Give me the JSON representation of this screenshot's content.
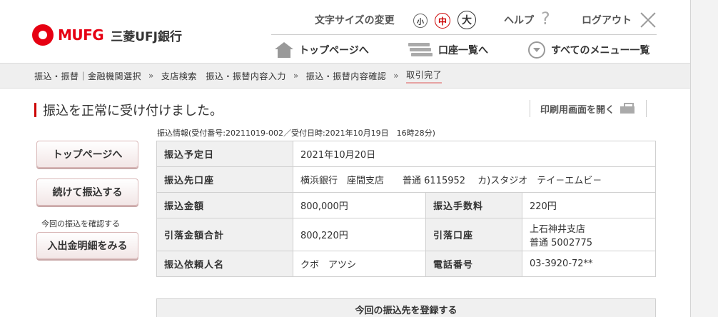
{
  "header": {
    "bank_brand": "MUFG",
    "bank_name": "三菱UFJ銀行",
    "font_size_label": "文字サイズの変更",
    "font_sizes": [
      "小",
      "中",
      "大"
    ],
    "help": "ヘルプ",
    "help_mark": "?",
    "logout": "ログアウト",
    "nav": {
      "top": "トップページへ",
      "accounts": "口座一覧へ",
      "all_menu": "すべてのメニュー一覧"
    }
  },
  "breadcrumb": {
    "steps": [
      "振込・振替｜金融機関選択",
      "支店検索　振込・振替内容入力",
      "振込・振替内容確認",
      "取引完了"
    ],
    "separator": "»"
  },
  "title": "振込を正常に受け付けました。",
  "print_label": "印刷用画面を開く",
  "info_caption": "振込情報(受付番号:20211019-002／受付日時:2021年10月19日　16時28分)",
  "side": {
    "top_button": "トップページへ",
    "continue_button": "続けて振込する",
    "note": "今回の振込を確認する",
    "detail_button": "入出金明細をみる"
  },
  "table": {
    "date_label": "振込予定日",
    "date_value": "2021年10月20日",
    "dest_label": "振込先口座",
    "dest_value": "横浜銀行　座間支店　　普通 6115952　 カ)スタジオ　テイ－エムビ－",
    "amount_label": "振込金額",
    "amount_value": "800,000円",
    "fee_label": "振込手数料",
    "fee_value": "220円",
    "total_label": "引落金額合計",
    "total_value": "800,220円",
    "debit_label": "引落口座",
    "debit_branch": "上石神井支店",
    "debit_account": "普通 5002775",
    "requester_label": "振込依頼人名",
    "requester_value": "クボ　アツシ",
    "phone_label": "電話番号",
    "phone_value": "03-3920-72**"
  },
  "register_label": "今回の振込先を登録する",
  "colors": {
    "brand_red": "#e60012",
    "accent_red": "#c00"
  }
}
